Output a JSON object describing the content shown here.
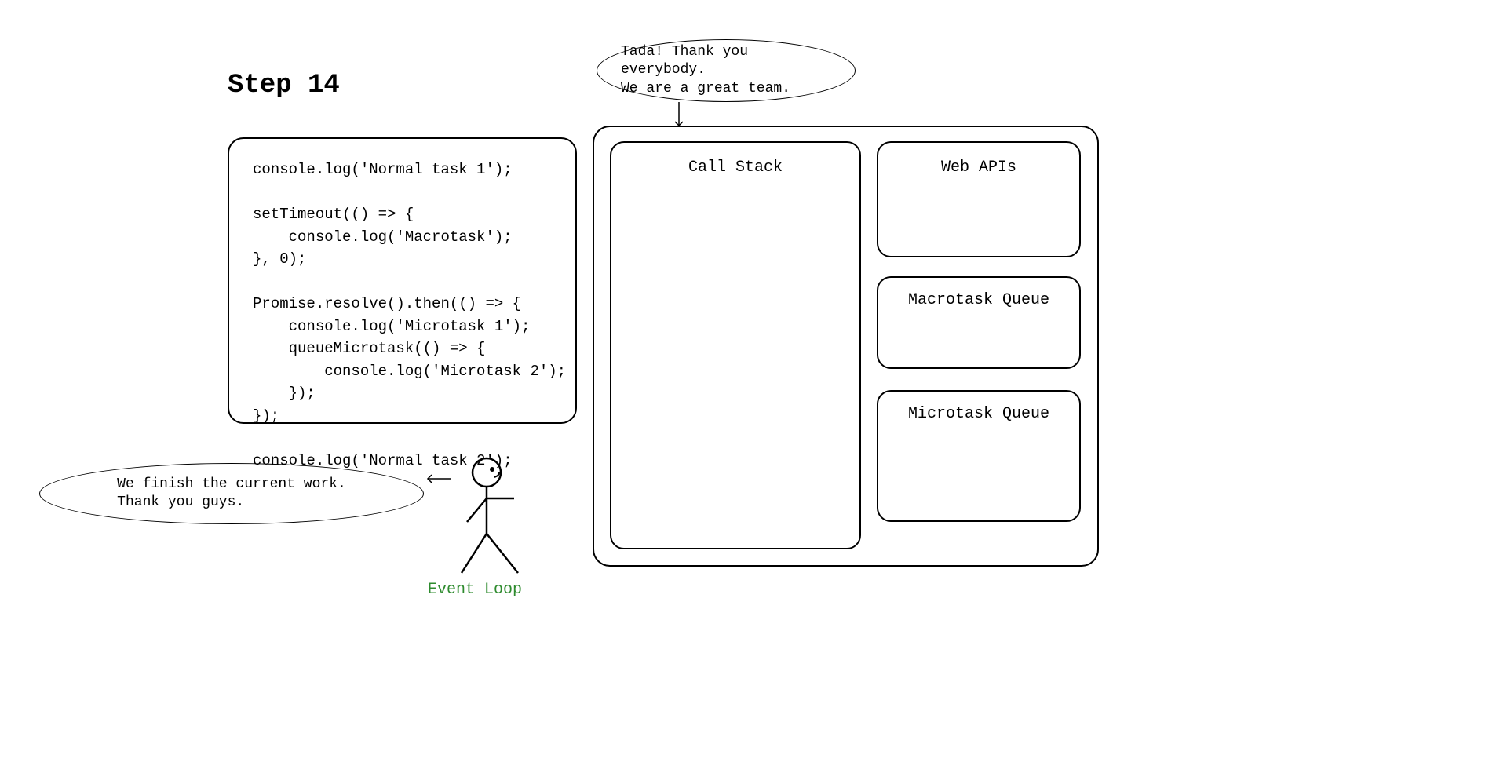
{
  "title": "Step 14",
  "code": "console.log('Normal task 1');\n\nsetTimeout(() => {\n    console.log('Macrotask');\n}, 0);\n\nPromise.resolve().then(() => {\n    console.log('Microtask 1');\n    queueMicrotask(() => {\n        console.log('Microtask 2');\n    });\n});\n\nconsole.log('Normal task 2');",
  "runtime": {
    "callStack": "Call Stack",
    "webApis": "Web APIs",
    "macrotaskQueue": "Macrotask Queue",
    "microtaskQueue": "Microtask Queue"
  },
  "bubbles": {
    "top": "Tada! Thank you everybody.\nWe are a great team.",
    "left": "We finish the current work.\nThank you guys."
  },
  "figureLabel": "Event Loop"
}
